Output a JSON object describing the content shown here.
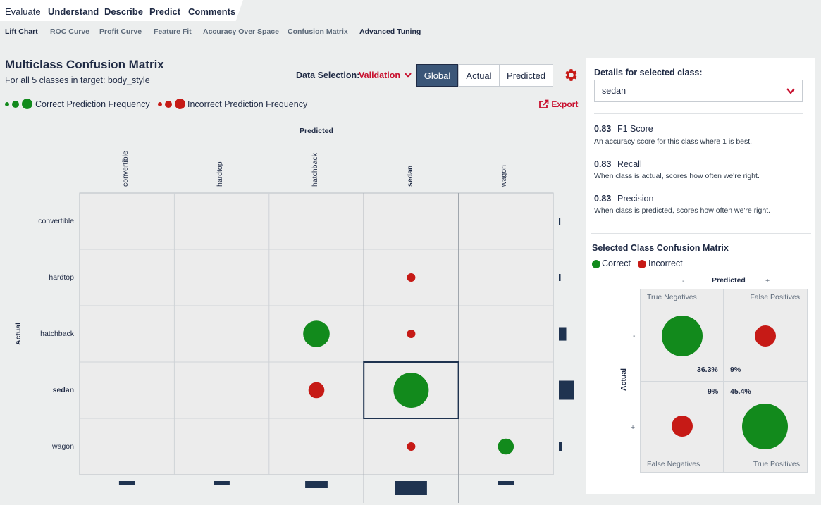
{
  "nav": {
    "tabs": [
      "Evaluate",
      "Understand",
      "Describe",
      "Predict",
      "Comments"
    ],
    "subtabs": [
      "Lift Chart",
      "ROC Curve",
      "Profit Curve",
      "Feature Fit",
      "Accuracy Over Space",
      "Confusion Matrix",
      "Advanced Tuning"
    ]
  },
  "header": {
    "title": "Multiclass Confusion Matrix",
    "subtitle": "For all 5 classes in target: body_style",
    "data_selection_label": "Data Selection:",
    "data_selection_value": "Validation",
    "view_buttons": [
      "Global",
      "Actual",
      "Predicted"
    ],
    "active_view": "Global",
    "export_label": "Export"
  },
  "legend": {
    "correct": "Correct Prediction Frequency",
    "incorrect": "Incorrect Prediction Frequency"
  },
  "colors": {
    "correct": "#128a1c",
    "incorrect": "#c61a16",
    "navy": "#1f3350",
    "accent_red": "#c8102e"
  },
  "matrix": {
    "predicted_title": "Predicted",
    "actual_title": "Actual",
    "classes": [
      "convertible",
      "hardtop",
      "hatchback",
      "sedan",
      "wagon"
    ],
    "selected_class": "sedan",
    "cells": [
      {
        "actual": "hardtop",
        "predicted": "sedan",
        "type": "incorrect",
        "size": 0.2
      },
      {
        "actual": "hatchback",
        "predicted": "hatchback",
        "type": "correct",
        "size": 0.75
      },
      {
        "actual": "hatchback",
        "predicted": "sedan",
        "type": "incorrect",
        "size": 0.2
      },
      {
        "actual": "sedan",
        "predicted": "hatchback",
        "type": "incorrect",
        "size": 0.45
      },
      {
        "actual": "sedan",
        "predicted": "sedan",
        "type": "correct",
        "size": 1.0
      },
      {
        "actual": "wagon",
        "predicted": "sedan",
        "type": "incorrect",
        "size": 0.2
      },
      {
        "actual": "wagon",
        "predicted": "wagon",
        "type": "correct",
        "size": 0.45
      }
    ],
    "actual_totals": [
      0.1,
      0.12,
      0.5,
      1.0,
      0.24
    ],
    "predicted_totals": [
      0.25,
      0.25,
      0.5,
      1.0,
      0.25
    ]
  },
  "details": {
    "heading": "Details for selected class:",
    "selected": "sedan",
    "metrics": [
      {
        "value": "0.83",
        "name": "F1 Score",
        "desc": "An accuracy score for this class where 1 is best."
      },
      {
        "value": "0.83",
        "name": "Recall",
        "desc": "When class is actual, scores how often we're right."
      },
      {
        "value": "0.83",
        "name": "Precision",
        "desc": "When class is predicted, scores how often we're right."
      }
    ],
    "mini_matrix": {
      "heading": "Selected Class Confusion Matrix",
      "legend_correct": "Correct",
      "legend_incorrect": "Incorrect",
      "predicted_label": "Predicted",
      "actual_label": "Actual",
      "minus": "-",
      "plus": "+",
      "tn_label": "True Negatives",
      "fp_label": "False Positives",
      "fn_label": "False Negatives",
      "tp_label": "True Positives",
      "tn_pct": "36.3%",
      "fp_pct": "9%",
      "fn_pct": "9%",
      "tp_pct": "45.4%"
    }
  }
}
